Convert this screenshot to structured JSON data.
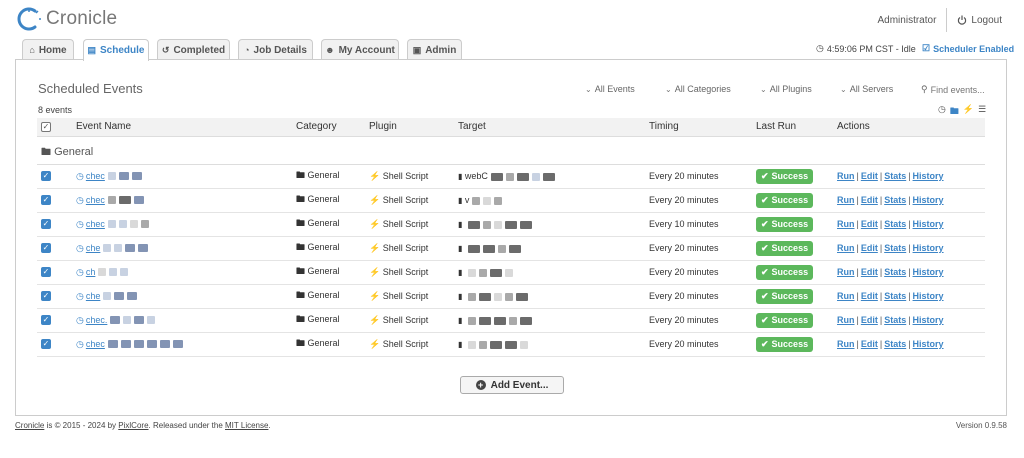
{
  "app": {
    "name": "Cronicle"
  },
  "header": {
    "user": "Administrator",
    "logout_label": "Logout"
  },
  "tabs": [
    {
      "label": "Home",
      "icon": "home-icon",
      "active": false
    },
    {
      "label": "Schedule",
      "icon": "calendar-icon",
      "active": true
    },
    {
      "label": "Completed",
      "icon": "history-icon",
      "active": false
    },
    {
      "label": "Job Details",
      "icon": "pie-chart-icon",
      "active": false
    },
    {
      "label": "My Account",
      "icon": "user-icon",
      "active": false
    },
    {
      "label": "Admin",
      "icon": "lock-icon",
      "active": false
    }
  ],
  "status": {
    "clock": "4:59:06 PM CST - Idle",
    "scheduler": "Scheduler Enabled"
  },
  "panel": {
    "title": "Scheduled Events",
    "count": "8 events",
    "filters": [
      "All Events",
      "All Categories",
      "All Plugins",
      "All Servers"
    ],
    "search_placeholder": "Find events..."
  },
  "table": {
    "headers": [
      "Event Name",
      "Category",
      "Plugin",
      "Target",
      "Timing",
      "Last Run",
      "Actions"
    ],
    "group": "General",
    "rows": [
      {
        "name": "chec",
        "category": "General",
        "plugin": "Shell Script",
        "target": "webC",
        "timing": "Every 20 minutes",
        "last_run": "Success"
      },
      {
        "name": "chec",
        "category": "General",
        "plugin": "Shell Script",
        "target": "v",
        "timing": "Every 20 minutes",
        "last_run": "Success"
      },
      {
        "name": "chec",
        "category": "General",
        "plugin": "Shell Script",
        "target": "",
        "timing": "Every 10 minutes",
        "last_run": "Success"
      },
      {
        "name": "che",
        "category": "General",
        "plugin": "Shell Script",
        "target": "",
        "timing": "Every 20 minutes",
        "last_run": "Success"
      },
      {
        "name": "ch",
        "category": "General",
        "plugin": "Shell Script",
        "target": "",
        "timing": "Every 20 minutes",
        "last_run": "Success"
      },
      {
        "name": "che",
        "category": "General",
        "plugin": "Shell Script",
        "target": "",
        "timing": "Every 20 minutes",
        "last_run": "Success"
      },
      {
        "name": "chec.",
        "category": "General",
        "plugin": "Shell Script",
        "target": "",
        "timing": "Every 20 minutes",
        "last_run": "Success"
      },
      {
        "name": "chec",
        "category": "General",
        "plugin": "Shell Script",
        "target": "",
        "timing": "Every 20 minutes",
        "last_run": "Success"
      }
    ],
    "actions": [
      "Run",
      "Edit",
      "Stats",
      "History"
    ]
  },
  "add_event_label": "Add Event...",
  "footer": {
    "app_link": "Cronicle",
    "text1": " is © 2015 - 2024 by ",
    "company_link": "PixlCore",
    "text2": ". Released under the ",
    "license_link": "MIT License",
    "text3": ".",
    "version": "Version 0.9.58"
  },
  "colors": {
    "accent": "#3d85c6",
    "success": "#5cb85c"
  }
}
